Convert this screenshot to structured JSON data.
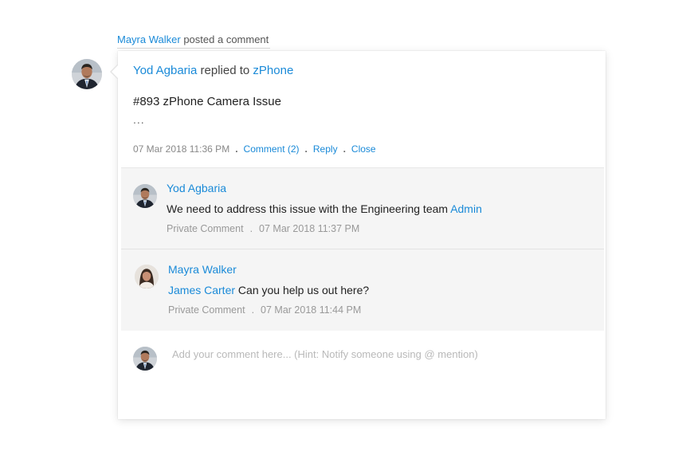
{
  "activity": {
    "actor": "Mayra Walker",
    "action": "posted a comment"
  },
  "post": {
    "author": "Yod Agbaria",
    "verb": "replied to",
    "target": "zPhone",
    "title": "#893 zPhone Camera Issue",
    "ellipsis": "...",
    "timestamp": "07 Mar 2018 11:36 PM",
    "actions": {
      "comment": "Comment (2)",
      "reply": "Reply",
      "close": "Close"
    },
    "separator": "."
  },
  "comments": [
    {
      "author": "Yod Agbaria",
      "text": "We need to address this issue with the Engineering team",
      "mention_after": "Admin",
      "visibility": "Private Comment",
      "timestamp": "07 Mar 2018 11:37 PM"
    },
    {
      "author": "Mayra Walker",
      "mention_before": "James Carter",
      "text": "Can you help us out here?",
      "visibility": "Private Comment",
      "timestamp": "07 Mar 2018 11:44 PM"
    }
  ],
  "composer": {
    "placeholder": "Add your comment here... (Hint: Notify someone using @ mention)",
    "value": ""
  },
  "colors": {
    "link": "#1a8ad8",
    "muted": "#999999",
    "comment_bg": "#f5f5f5"
  },
  "icons": {
    "avatar_male": "man-avatar-photo",
    "avatar_female": "woman-avatar-photo"
  }
}
